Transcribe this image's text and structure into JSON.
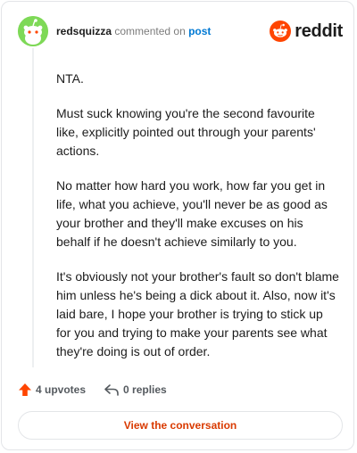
{
  "header": {
    "username": "redsquizza",
    "commented_text": "commented on",
    "post_link": "post",
    "avatar_icon": "snoo-avatar-icon",
    "avatar_color": "#7ed957"
  },
  "brand": {
    "logo_icon": "reddit-logo-icon",
    "wordmark": "reddit",
    "color": "#ff4500"
  },
  "comment": {
    "paragraphs": [
      "NTA.",
      "Must suck knowing you're the second favourite like, explicitly pointed out through your parents' actions.",
      "No matter how hard you work, how far you get in life, what you achieve, you'll never be as good as your brother and they'll make excuses on his behalf if he doesn't achieve similarly to you.",
      "It's obviously not your brother's fault so don't blame him unless he's being a dick about it. Also, now it's laid bare, I hope your brother is trying to stick up for you and trying to make your parents see what they're doing is out of order."
    ]
  },
  "actions": {
    "upvotes_label": "4 upvotes",
    "replies_label": "0 replies",
    "upvote_color": "#ff4500"
  },
  "footer": {
    "view_conversation_label": "View the conversation",
    "accent": "#d93a00"
  }
}
